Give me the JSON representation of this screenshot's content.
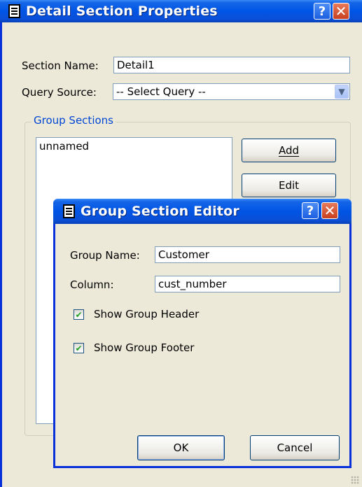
{
  "detail_window": {
    "title": "Detail Section Properties",
    "section_name_label": "Section Name:",
    "section_name_value": "Detail1",
    "query_source_label": "Query Source:",
    "query_source_value": "-- Select Query --",
    "group_sections_legend": "Group Sections",
    "group_list_items": [
      "unnamed"
    ],
    "add_button": "Add",
    "edit_button": "Edit"
  },
  "group_editor": {
    "title": "Group Section Editor",
    "group_name_label": "Group Name:",
    "group_name_value": "Customer",
    "column_label": "Column:",
    "column_value": "cust_number",
    "show_header_label": "Show Group Header",
    "show_header_checked": true,
    "show_footer_label": "Show Group Footer",
    "show_footer_checked": true,
    "ok_button": "OK",
    "cancel_button": "Cancel"
  },
  "icons": {
    "help": "?",
    "close": "✕",
    "dropdown": "chevron-down-icon",
    "check": "✔"
  },
  "colors": {
    "titlebar": "#0055e5",
    "window_bg": "#ece9d8",
    "groupbox_legend": "#0046d5",
    "checkmark": "#21a121"
  }
}
